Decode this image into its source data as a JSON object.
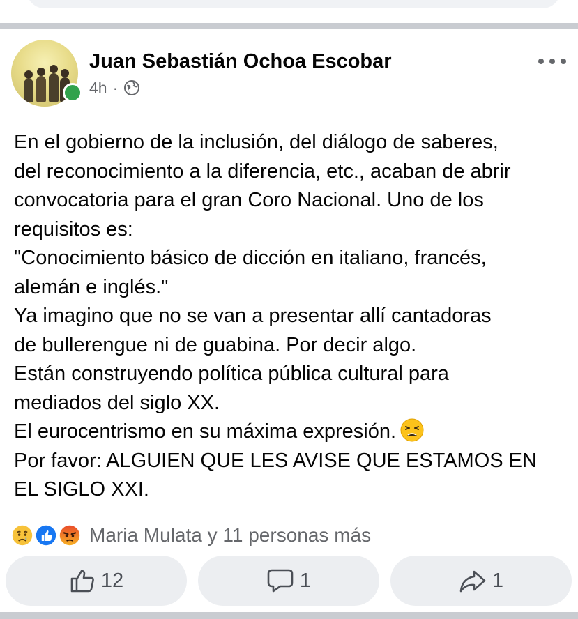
{
  "post": {
    "author": "Juan Sebastián Ochoa Escobar",
    "time": "4h",
    "separator": "·",
    "privacy_icon": "globe-icon",
    "body_lines": [
      "En el gobierno de la inclusión, del diálogo de saberes,",
      "del reconocimiento a la diferencia, etc., acaban de abrir",
      "convocatoria para el gran Coro Nacional. Uno de los",
      "requisitos es:",
      "\"Conocimiento básico de dicción en italiano, francés,",
      "alemán e inglés.\"",
      "Ya imagino que no se van a presentar allí cantadoras",
      "de bullerengue ni de guabina. Por decir algo.",
      "Están construyendo política pública cultural para",
      "mediados del siglo XX.",
      "El eurocentrismo en su máxima expresión.",
      "Por favor: ALGUIEN QUE LES AVISE QUE ESTAMOS EN",
      "EL SIGLO XXI."
    ],
    "inline_emoji": "weary-face-emoji"
  },
  "reactions": {
    "icons": [
      "sad-reaction-icon",
      "like-reaction-icon",
      "angry-reaction-icon"
    ],
    "summary": "Maria Mulata y 11 personas más"
  },
  "actions": {
    "like_count": "12",
    "comment_count": "1",
    "share_count": "1"
  },
  "colors": {
    "like_blue": "#1877f2",
    "online_green": "#31a24c",
    "secondary_text": "#65676b",
    "button_bg": "#eceef1"
  }
}
